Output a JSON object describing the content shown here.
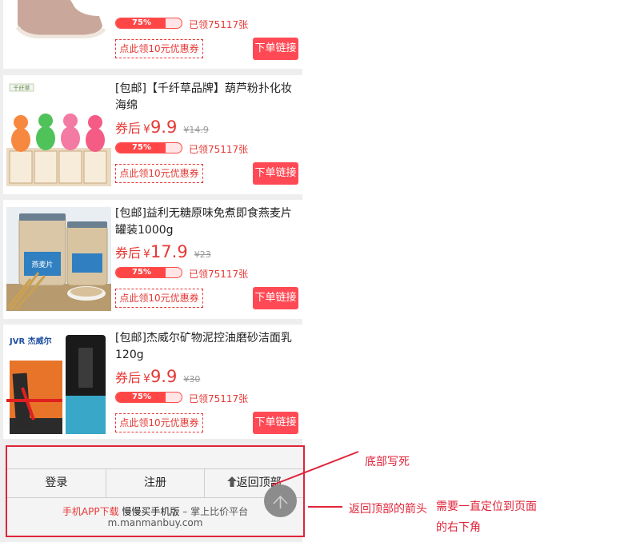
{
  "top_partial": {
    "progress_percent": 75,
    "progress_label": "75%",
    "claimed": "已领75117张",
    "coupon": "点此领10元优惠券",
    "buy": "下单链接"
  },
  "products": [
    {
      "title": "[包邮]【千纤草品牌】葫芦粉扑化妆海绵",
      "price_label": "券后",
      "currency": "¥",
      "price": "9.9",
      "old_price": "¥14.9",
      "progress_percent": 75,
      "progress_label": "75%",
      "claimed": "已领75117张",
      "coupon": "点此领10元优惠券",
      "buy": "下单链接",
      "brand_text": "千纤草"
    },
    {
      "title": "[包邮]益利无糖原味免煮即食燕麦片罐装1000g",
      "price_label": "券后",
      "currency": "¥",
      "price": "17.9",
      "old_price": "¥23",
      "progress_percent": 75,
      "progress_label": "75%",
      "claimed": "已领75117张",
      "coupon": "点此领10元优惠券",
      "buy": "下单链接",
      "brand_text": "燕麦片"
    },
    {
      "title": "[包邮]杰威尔矿物泥控油磨砂洁面乳120g",
      "price_label": "券后",
      "currency": "¥",
      "price": "9.9",
      "old_price": "¥30",
      "progress_percent": 75,
      "progress_label": "75%",
      "claimed": "已领75117张",
      "coupon": "点此领10元优惠券",
      "buy": "下单链接",
      "brand_text": "JVR 杰威尔"
    }
  ],
  "footer": {
    "login": "登录",
    "register": "注册",
    "back_to_top": "返回顶部",
    "app_download": "手机APP下载",
    "slogan": "慢慢买手机版",
    "tagline": "– 掌上比价平台",
    "url": "m.manmanbuy.com"
  },
  "annotations": {
    "footer_note": "底部写死",
    "arrow_note": "返回顶部的箭头",
    "position_note_line1": "需要一直定位到页面",
    "position_note_line2": "的右下角"
  },
  "colors": {
    "accent": "#e53935",
    "buy_button": "#ff4a55",
    "annotation": "#e0243a"
  },
  "icons": {
    "back_to_top_arrow": "up-arrow-icon",
    "floating_button": "arrow-up-icon"
  }
}
